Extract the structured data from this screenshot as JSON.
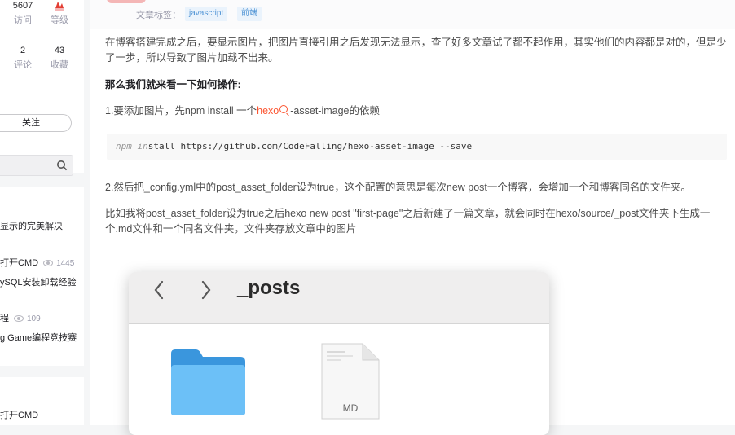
{
  "sidebar": {
    "stats": [
      {
        "num": "5607",
        "label": "访问"
      },
      {
        "num": "",
        "label": "等级"
      },
      {
        "num": "2",
        "label": "评论"
      },
      {
        "num": "43",
        "label": "收藏"
      }
    ],
    "follow_label": "关注",
    "search_placeholder": "",
    "items": [
      {
        "text": "显示的完美解决",
        "views": ""
      },
      {
        "text": "打开CMD",
        "views": "1445"
      },
      {
        "text": "ySQL安装卸载经验",
        "views": ""
      },
      {
        "text": "程",
        "views": "109"
      },
      {
        "text": "g Game编程竞技赛",
        "views": ""
      },
      {
        "text": "打开CMD",
        "views": ""
      }
    ]
  },
  "article": {
    "tag_label": "文章标签：",
    "tags": [
      "javascript",
      "前端"
    ],
    "intro": "在博客搭建完成之后，要显示图片，把图片直接引用之后发现无法显示，查了好多文章试了都不起作用，其实他们的内容都是对的，但是少了一步，所以导致了图片加载不出来。",
    "heading": "那么我们就来看一下如何操作:",
    "step1_prefix": "1.要添加图片，先npm install 一个",
    "step1_link": "hexo",
    "step1_suffix": "-asset-image的依赖",
    "code_kw1": "npm",
    "code_kw2": "in",
    "code_rest": "stall https://github.com/CodeFalling/hexo-asset-image --save",
    "step2": "2.然后把_config.yml中的post_asset_folder设为true，这个配置的意思是每次new post一个博客，会增加一个和博客同名的文件夹。",
    "step3": "比如我将post_asset_folder设为true之后hexo new post \"first-page\"之后新建了一篇文章，就会同时在hexo/source/_post文件夹下生成一个.md文件和一个同名文件夹，文件夹存放文章中的图片"
  },
  "finder": {
    "title": "_posts",
    "file_label": "MD"
  },
  "colors": {
    "accent": "#fc5531",
    "tag_text": "#5094d5",
    "folder": "#4aa8ec"
  }
}
